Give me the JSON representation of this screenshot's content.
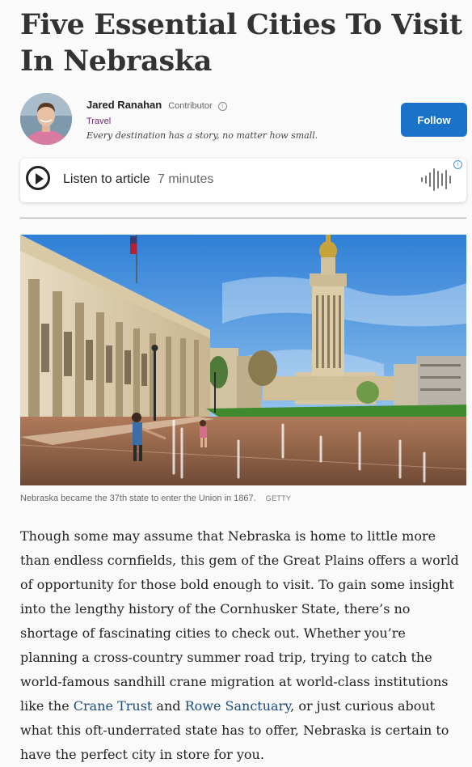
{
  "article": {
    "title": "Five Essential Cities To Visit In Nebraska"
  },
  "author": {
    "name": "Jared Ranahan",
    "role": "Contributor",
    "category": "Travel",
    "tagline": "Every destination has a story, no matter how small.",
    "follow_label": "Follow"
  },
  "listen": {
    "label": "Listen to article",
    "duration": "7 minutes",
    "icon": "play-icon",
    "ad_icon": "i"
  },
  "image": {
    "caption": "Nebraska became the 37th state to enter the Union in 1867.",
    "credit": "GETTY"
  },
  "body": {
    "p1_before": "Though some may assume that Nebraska is home to little more than endless cornfields, this gem of the Great Plains offers a world of opportunity for those bold enough to visit. To gain some insight into the lengthy history of the Cornhusker State, there’s no shortage of fascinating cities to check out. Whether you’re planning a cross-country summer road trip, trying to catch the world-famous sandhill crane migration at world-class institutions like the ",
    "link1": "Crane Trust",
    "p1_mid": " and ",
    "link2": "Rowe Sanctuary",
    "p1_after": ", or just curious about what this oft-underrated state has to offer, Nebraska is certain to have the perfect city in store for you."
  },
  "colors": {
    "follow_button": "#1a73c8",
    "link": "#1a4a7e",
    "category": "#6a2a6e"
  }
}
